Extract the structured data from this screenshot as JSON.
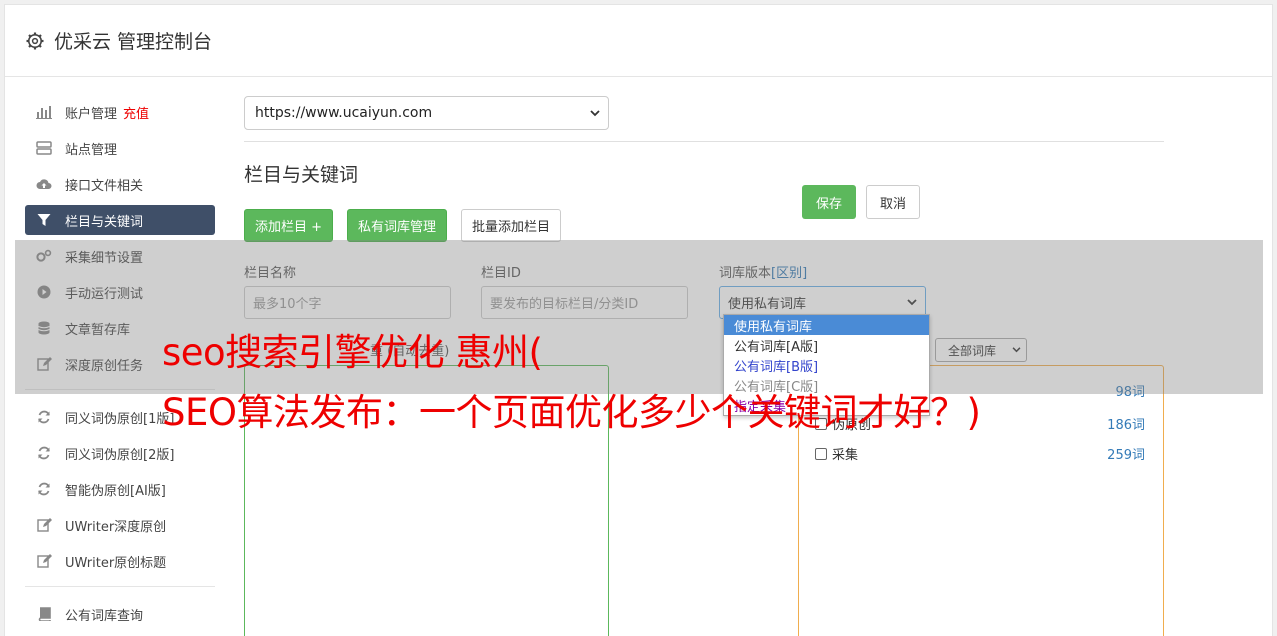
{
  "app": {
    "title": "优采云 管理控制台"
  },
  "sidebar": {
    "items": [
      {
        "label": "账户管理",
        "badge": "充值",
        "icon": "bar-chart-icon"
      },
      {
        "label": "站点管理",
        "icon": "server-icon"
      },
      {
        "label": "接口文件相关",
        "icon": "cloud-upload-icon"
      },
      {
        "label": "栏目与关键词",
        "icon": "filter-icon",
        "active": true
      },
      {
        "label": "采集细节设置",
        "icon": "gears-icon"
      },
      {
        "label": "手动运行测试",
        "icon": "play-circle-icon"
      },
      {
        "label": "文章暂存库",
        "icon": "database-icon"
      },
      {
        "label": "深度原创任务",
        "icon": "edit-icon"
      }
    ],
    "items2": [
      {
        "label": "同义词伪原创[1版]",
        "icon": "refresh-icon"
      },
      {
        "label": "同义词伪原创[2版]",
        "icon": "refresh-icon"
      },
      {
        "label": "智能伪原创[AI版]",
        "icon": "refresh-icon"
      },
      {
        "label": "UWriter深度原创",
        "icon": "edit-icon"
      },
      {
        "label": "UWriter原创标题",
        "icon": "edit-icon"
      }
    ],
    "items3": [
      {
        "label": "公有词库查询",
        "icon": "book-icon"
      }
    ]
  },
  "main": {
    "site_select": "https://www.ucaiyun.com",
    "section_title": "栏目与关键词",
    "buttons": {
      "add_column": "添加栏目 +",
      "private_lib": "私有词库管理",
      "batch_add": "批量添加栏目"
    },
    "form": {
      "name_label": "栏目名称",
      "name_placeholder": "最多10个字",
      "id_label": "栏目ID",
      "id_placeholder": "要发布的目标栏目/分类ID",
      "version_label": "词库版本",
      "version_link": "[区别]",
      "version_value": "使用私有词库",
      "save": "保存",
      "cancel": "取消"
    },
    "keyword_label": "重 (自动去重)",
    "lib_filter": "全部词库",
    "dropdown_options": [
      "使用私有词库",
      "公有词库[A版]",
      "公有词库[B版]",
      "公有词库[C版]",
      "指定采集"
    ],
    "libs": [
      {
        "name": "",
        "count": "98词"
      },
      {
        "name": "伪原创",
        "count": "186词"
      },
      {
        "name": "采集",
        "count": "259词"
      }
    ]
  },
  "headline": {
    "line1": "seo搜索引擎优化 惠州(",
    "line2": "SEO算法发布：一个页面优化多少个关键词才好？)"
  },
  "colors": {
    "active_nav": "#3f4f68",
    "green": "#5cb85c",
    "headline": "#ee0000",
    "link": "#337ab7"
  }
}
